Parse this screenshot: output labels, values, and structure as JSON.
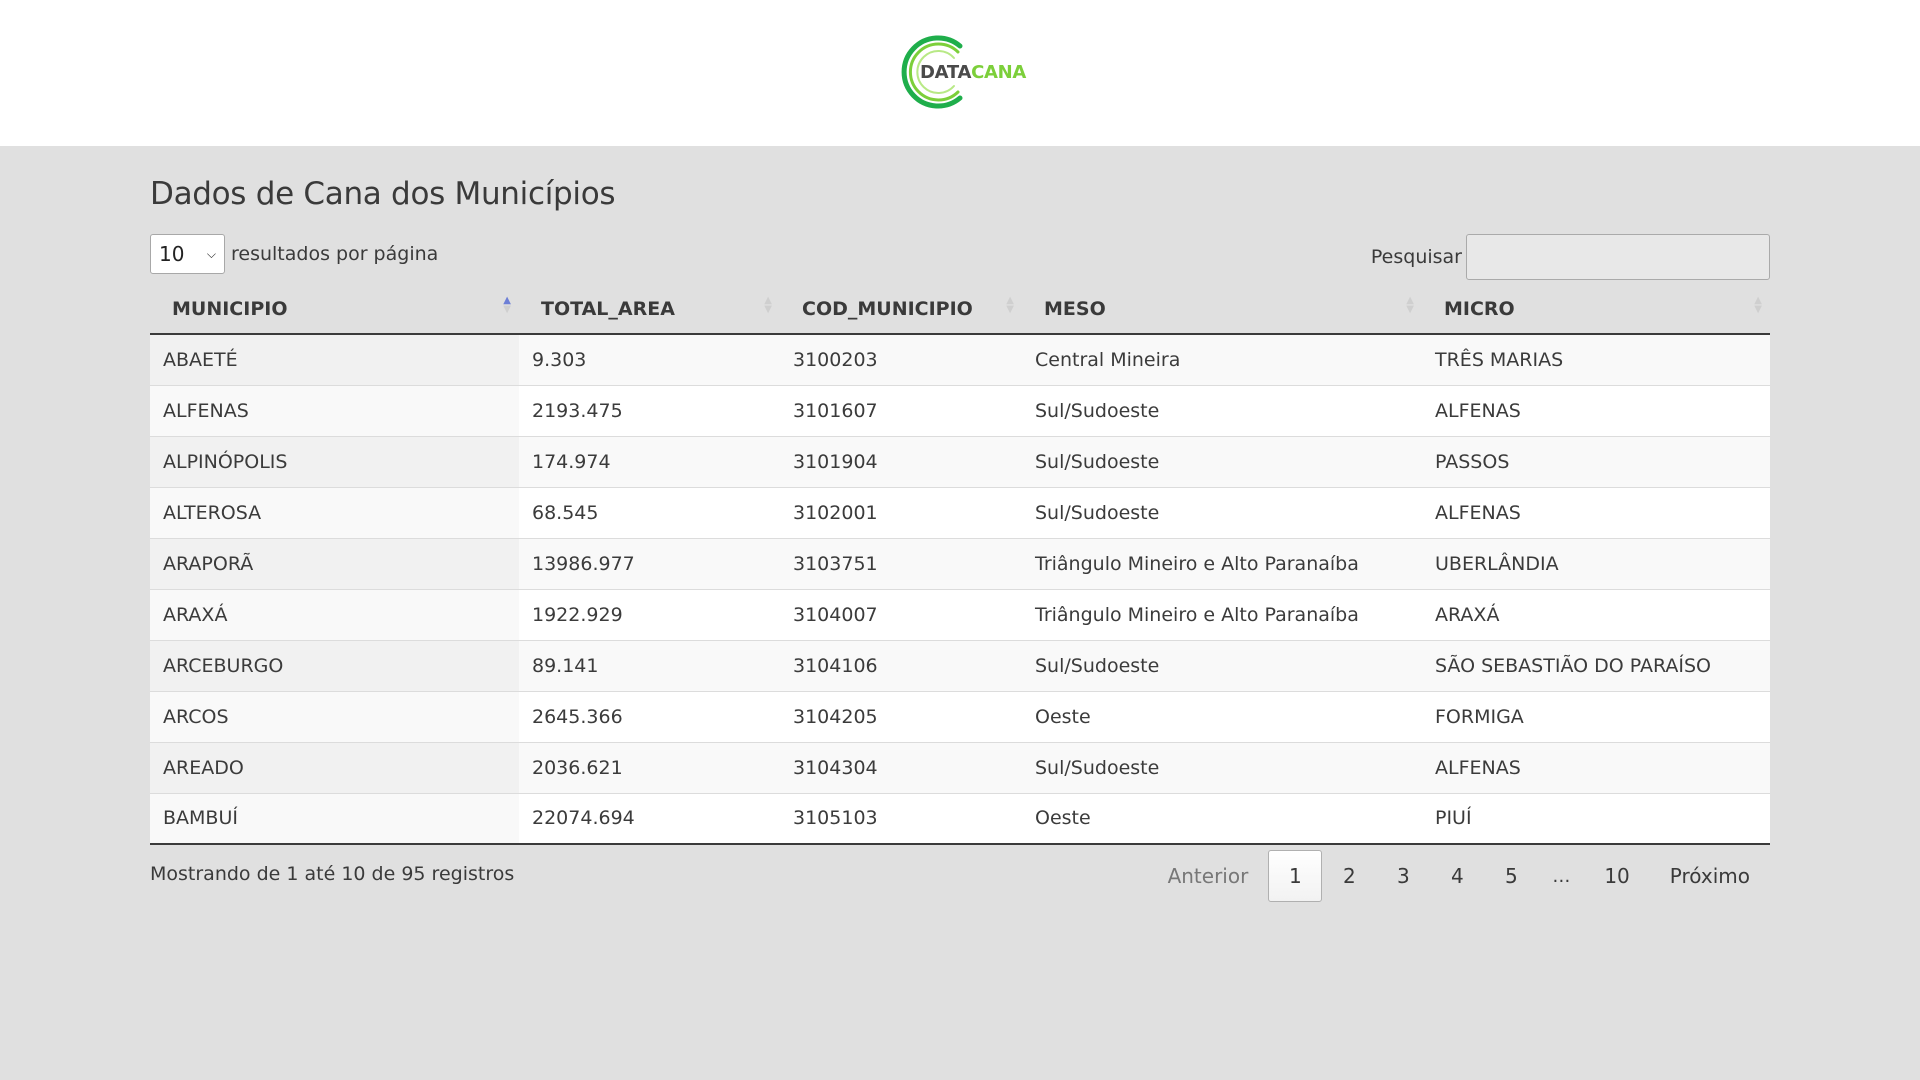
{
  "brand": {
    "logo_part1": "DATA",
    "logo_part2": "CANA",
    "colors": {
      "green_light": "#7ccf3a",
      "green_dark": "#1fae4b",
      "text": "#4a4a4a"
    }
  },
  "page": {
    "title": "Dados de Cana dos Municípios"
  },
  "length_control": {
    "selected": "10",
    "label": "resultados por página"
  },
  "search": {
    "label": "Pesquisar",
    "value": ""
  },
  "table": {
    "columns": [
      "MUNICIPIO",
      "TOTAL_AREA",
      "COD_MUNICIPIO",
      "MESO",
      "MICRO"
    ],
    "sorted_column": "MUNICIPIO",
    "sort_direction": "asc",
    "rows": [
      [
        "ABAETÉ",
        "9.303",
        "3100203",
        "Central Mineira",
        "TRÊS MARIAS"
      ],
      [
        "ALFENAS",
        "2193.475",
        "3101607",
        "Sul/Sudoeste",
        "ALFENAS"
      ],
      [
        "ALPINÓPOLIS",
        "174.974",
        "3101904",
        "Sul/Sudoeste",
        "PASSOS"
      ],
      [
        "ALTEROSA",
        "68.545",
        "3102001",
        "Sul/Sudoeste",
        "ALFENAS"
      ],
      [
        "ARAPORÃ",
        "13986.977",
        "3103751",
        "Triângulo Mineiro e Alto Paranaíba",
        "UBERLÂNDIA"
      ],
      [
        "ARAXÁ",
        "1922.929",
        "3104007",
        "Triângulo Mineiro e Alto Paranaíba",
        "ARAXÁ"
      ],
      [
        "ARCEBURGO",
        "89.141",
        "3104106",
        "Sul/Sudoeste",
        "SÃO SEBASTIÃO DO PARAÍSO"
      ],
      [
        "ARCOS",
        "2645.366",
        "3104205",
        "Oeste",
        "FORMIGA"
      ],
      [
        "AREADO",
        "2036.621",
        "3104304",
        "Sul/Sudoeste",
        "ALFENAS"
      ],
      [
        "BAMBUÍ",
        "22074.694",
        "3105103",
        "Oeste",
        "PIUÍ"
      ]
    ]
  },
  "info": {
    "text": "Mostrando de 1 até 10 de 95 registros"
  },
  "pagination": {
    "previous": "Anterior",
    "pages": [
      "1",
      "2",
      "3",
      "4",
      "5"
    ],
    "ellipsis": "…",
    "last": "10",
    "next": "Próximo",
    "current": "1"
  }
}
